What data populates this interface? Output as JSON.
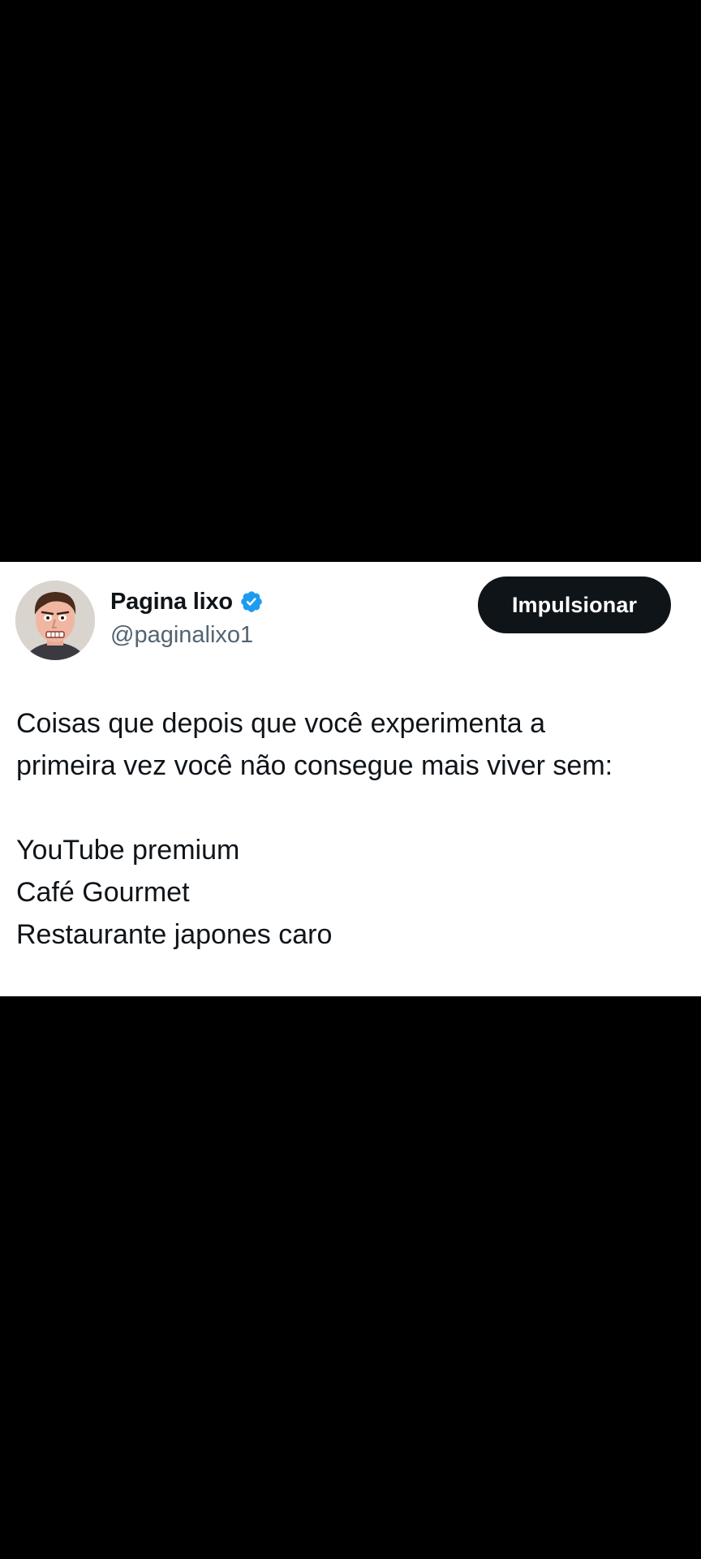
{
  "tweet": {
    "author": {
      "display_name": "Pagina lixo",
      "handle": "@paginalixo1",
      "verified": true,
      "verified_badge_color": "#1d9bf0"
    },
    "action_button": {
      "label": "Impulsionar",
      "background": "#0f1419"
    },
    "text": {
      "intro_line_1": "Coisas que depois que você experimenta a",
      "intro_line_2": "primeira vez você não consegue mais viver sem:",
      "items": [
        "YouTube premium",
        "Café Gourmet",
        "Restaurante japones caro"
      ]
    }
  },
  "colors": {
    "background": "#000000",
    "card": "#ffffff",
    "primary_text": "#0f1419",
    "secondary_text": "#536471"
  }
}
